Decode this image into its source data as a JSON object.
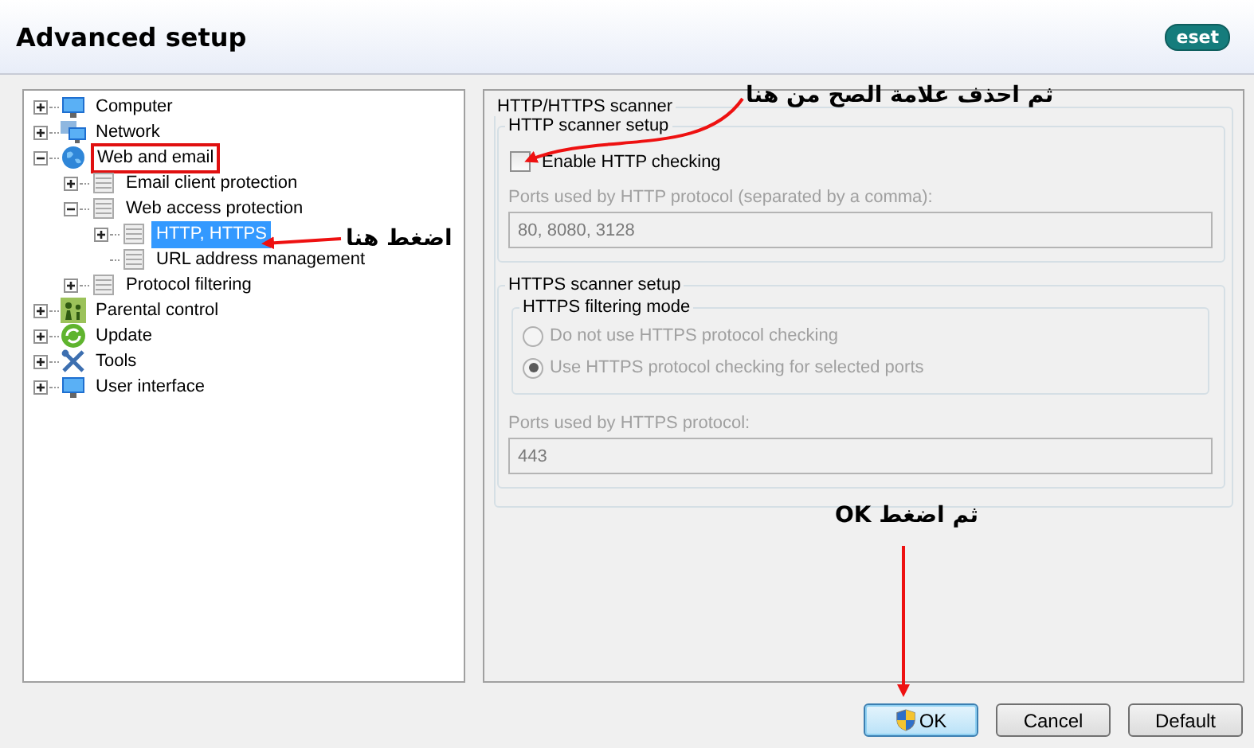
{
  "window": {
    "title": "Advanced setup",
    "logo": "eset"
  },
  "tree": [
    {
      "label": "Computer",
      "kind": "computer",
      "expanded": false,
      "selected": false,
      "highlighted": false
    },
    {
      "label": "Network",
      "kind": "network",
      "expanded": false,
      "selected": false,
      "highlighted": false
    },
    {
      "label": "Web and email",
      "kind": "globe",
      "expanded": true,
      "selected": false,
      "highlighted": true,
      "children": [
        {
          "label": "Email client protection",
          "kind": "page",
          "expanded": false,
          "selected": false,
          "highlighted": false
        },
        {
          "label": "Web access protection",
          "kind": "page",
          "expanded": true,
          "selected": false,
          "highlighted": false,
          "children": [
            {
              "label": "HTTP, HTTPS",
              "kind": "page",
              "expanded": false,
              "selected": true,
              "highlighted": false
            },
            {
              "label": "URL address management",
              "kind": "page",
              "selected": false,
              "highlighted": false
            }
          ]
        },
        {
          "label": "Protocol filtering",
          "kind": "page",
          "expanded": false,
          "selected": false,
          "highlighted": false
        }
      ]
    },
    {
      "label": "Parental control",
      "kind": "people",
      "expanded": false,
      "selected": false,
      "highlighted": false
    },
    {
      "label": "Update",
      "kind": "update",
      "expanded": false,
      "selected": false,
      "highlighted": false
    },
    {
      "label": "Tools",
      "kind": "tools",
      "expanded": false,
      "selected": false,
      "highlighted": false
    },
    {
      "label": "User interface",
      "kind": "computer",
      "expanded": false,
      "selected": false,
      "highlighted": false
    }
  ],
  "scanner": {
    "title": "HTTP/HTTPS scanner",
    "http": {
      "title": "HTTP scanner setup",
      "checkbox": {
        "label": "Enable HTTP checking",
        "checked": false
      },
      "ports_label": "Ports used by HTTP protocol (separated by a comma):",
      "ports": "80, 8080, 3128",
      "disabled": true
    },
    "https": {
      "title": "HTTPS scanner setup",
      "mode_title": "HTTPS filtering mode",
      "modes": [
        {
          "label": "Do not use HTTPS protocol checking",
          "selected": false
        },
        {
          "label": "Use HTTPS protocol checking for selected ports",
          "selected": true
        }
      ],
      "ports_label": "Ports used by HTTPS protocol:",
      "ports": "443",
      "disabled": true
    }
  },
  "buttons": [
    {
      "label": "OK",
      "default": true
    },
    {
      "label": "Cancel",
      "default": false
    },
    {
      "label": "Default",
      "default": false
    }
  ],
  "annotations": [
    {
      "text": "ثم احذف علامة الصح من هنا"
    },
    {
      "text": "اضغط هنا"
    },
    {
      "text": "ثم اضغط OK"
    }
  ]
}
